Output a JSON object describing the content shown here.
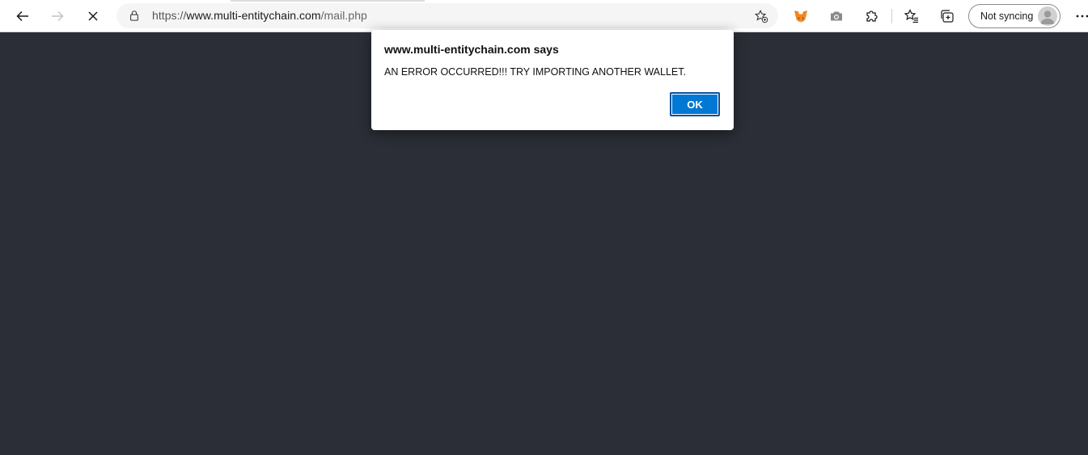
{
  "browser": {
    "address": {
      "scheme": "https://",
      "host": "www.multi-entitychain.com",
      "path": "/mail.php"
    },
    "icons": {
      "back": "arrow-left-icon",
      "forward": "arrow-right-icon",
      "stop": "close-icon",
      "lock": "lock-icon",
      "add_favorite": "star-add-icon",
      "metamask": "metamask-fox-icon",
      "screenshot": "camera-icon",
      "extensions": "puzzle-icon",
      "favorites": "star-list-icon",
      "collections": "collections-icon",
      "more": "more-dots-icon"
    },
    "profile": {
      "label": "Not syncing"
    }
  },
  "dialog": {
    "title": "www.multi-entitychain.com says",
    "message": "AN ERROR OCCURRED!!! TRY IMPORTING ANOTHER WALLET.",
    "ok_label": "OK"
  },
  "colors": {
    "page_background": "#2b2e36",
    "accent": "#0078d4",
    "metamask_orange": "#e2761b"
  }
}
